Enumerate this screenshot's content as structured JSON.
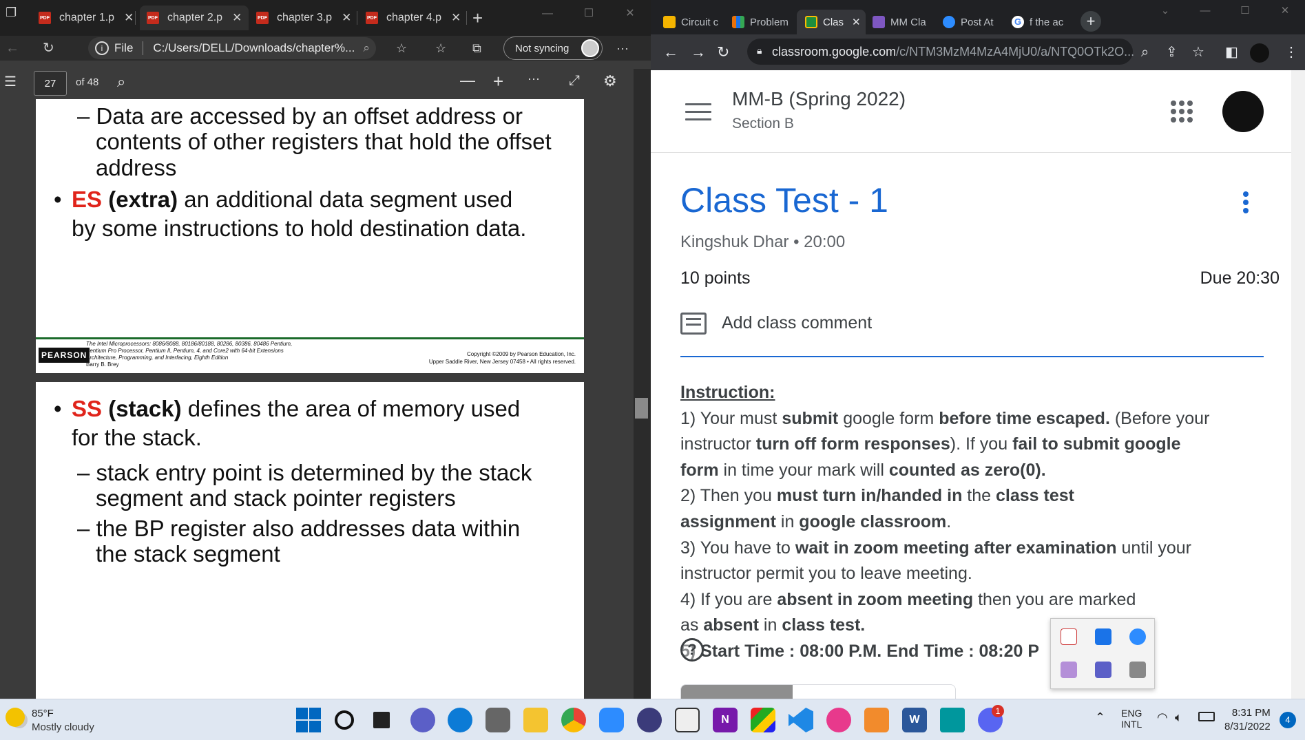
{
  "edge": {
    "tabs": [
      "chapter 1.p",
      "chapter 2.p",
      "chapter 3.p",
      "chapter 4.p"
    ],
    "address": {
      "file_label": "File",
      "url": "C:/Users/DELL/Downloads/chapter%..."
    },
    "sync": "Not syncing",
    "pdf_toolbar": {
      "page": "27",
      "of": "of 48"
    },
    "slide1": {
      "line1": "– Data are accessed by an offset address or",
      "line2": "contents of other registers that hold the offset",
      "line3": "address",
      "es_abbr": "ES",
      "es_word": "(extra)",
      "es_rest": "an additional data segment used",
      "es_line2": "by some instructions to hold destination data."
    },
    "footer": {
      "publisher": "PEARSON",
      "book1": "The Intel Microprocessors: 8086/8088, 80186/80188, 80286, 80386, 80486 Pentium,",
      "book2": "Pentium Pro Processor, Pentium II, Pentium, 4, and Core2 with 64-bit Extensions",
      "book3": "Architecture, Programming, and Interfacing, Eighth Edition",
      "author": "Barry B. Brey",
      "copy1": "Copyright ©2009 by Pearson Education, Inc.",
      "copy2": "Upper Saddle River, New Jersey 07458 • All rights reserved."
    },
    "slide2": {
      "ss_abbr": "SS",
      "ss_word": "(stack)",
      "ss_rest": "defines the area of memory used",
      "ss_line2": "for the stack.",
      "sub1a": "– stack entry point is determined by the stack",
      "sub1b": "segment and stack pointer registers",
      "sub2a": "– the BP register also addresses data within",
      "sub2b": "the stack segment"
    }
  },
  "chrome": {
    "tabs": [
      "Circuit c",
      "Problem",
      "Clas",
      "MM Cla",
      "Post At",
      "f the ac"
    ],
    "url_host": "classroom.google.com",
    "url_path": "/c/NTM3MzM4MzA4MjU0/a/NTQ0OTk2O...",
    "course": {
      "title": "MM-B (Spring 2022)",
      "section": "Section B"
    },
    "assignment": {
      "title": "Class Test - 1",
      "author": "Kingshuk Dhar",
      "time": "20:00",
      "points": "10 points",
      "due": "Due 20:30",
      "comment": "Add class comment"
    },
    "instruction": {
      "heading": "Instruction:",
      "l1a": "1) Your must ",
      "l1b": "submit",
      "l1c": " google form ",
      "l1d": "before time escaped.",
      "l1e": " (Before your",
      "l2a": "instructor ",
      "l2b": "turn off form responses",
      "l2c": "). If you ",
      "l2d": "fail to submit google",
      "l3a": "form",
      "l3b": " in time your mark will ",
      "l3c": "counted as zero(0).",
      "l4a": "2) Then you ",
      "l4b": "must turn in/handed in",
      "l4c": " the ",
      "l4d": "class test",
      "l5a": "assignment",
      "l5b": " in ",
      "l5c": "google classroom",
      "l5d": ".",
      "l6a": "3) You have to ",
      "l6b": "wait in zoom meeting after examination",
      "l6c": " until your",
      "l7": "instructor permit you to leave meeting.",
      "l8a": "4) If you are ",
      "l8b": "absent in zoom meeting",
      "l8c": " then you are marked",
      "l9a": "as ",
      "l9b": "absent",
      "l9c": " in ",
      "l9d": "class test.",
      "l10": "5) Start Time : 08:00 P.M. End Time : 08:20 P"
    }
  },
  "taskbar": {
    "weather_temp": "85°F",
    "weather_desc": "Mostly cloudy",
    "lang1": "ENG",
    "lang2": "INTL",
    "time": "8:31 PM",
    "date": "8/31/2022",
    "notif": "4",
    "discord_badge": "1"
  }
}
